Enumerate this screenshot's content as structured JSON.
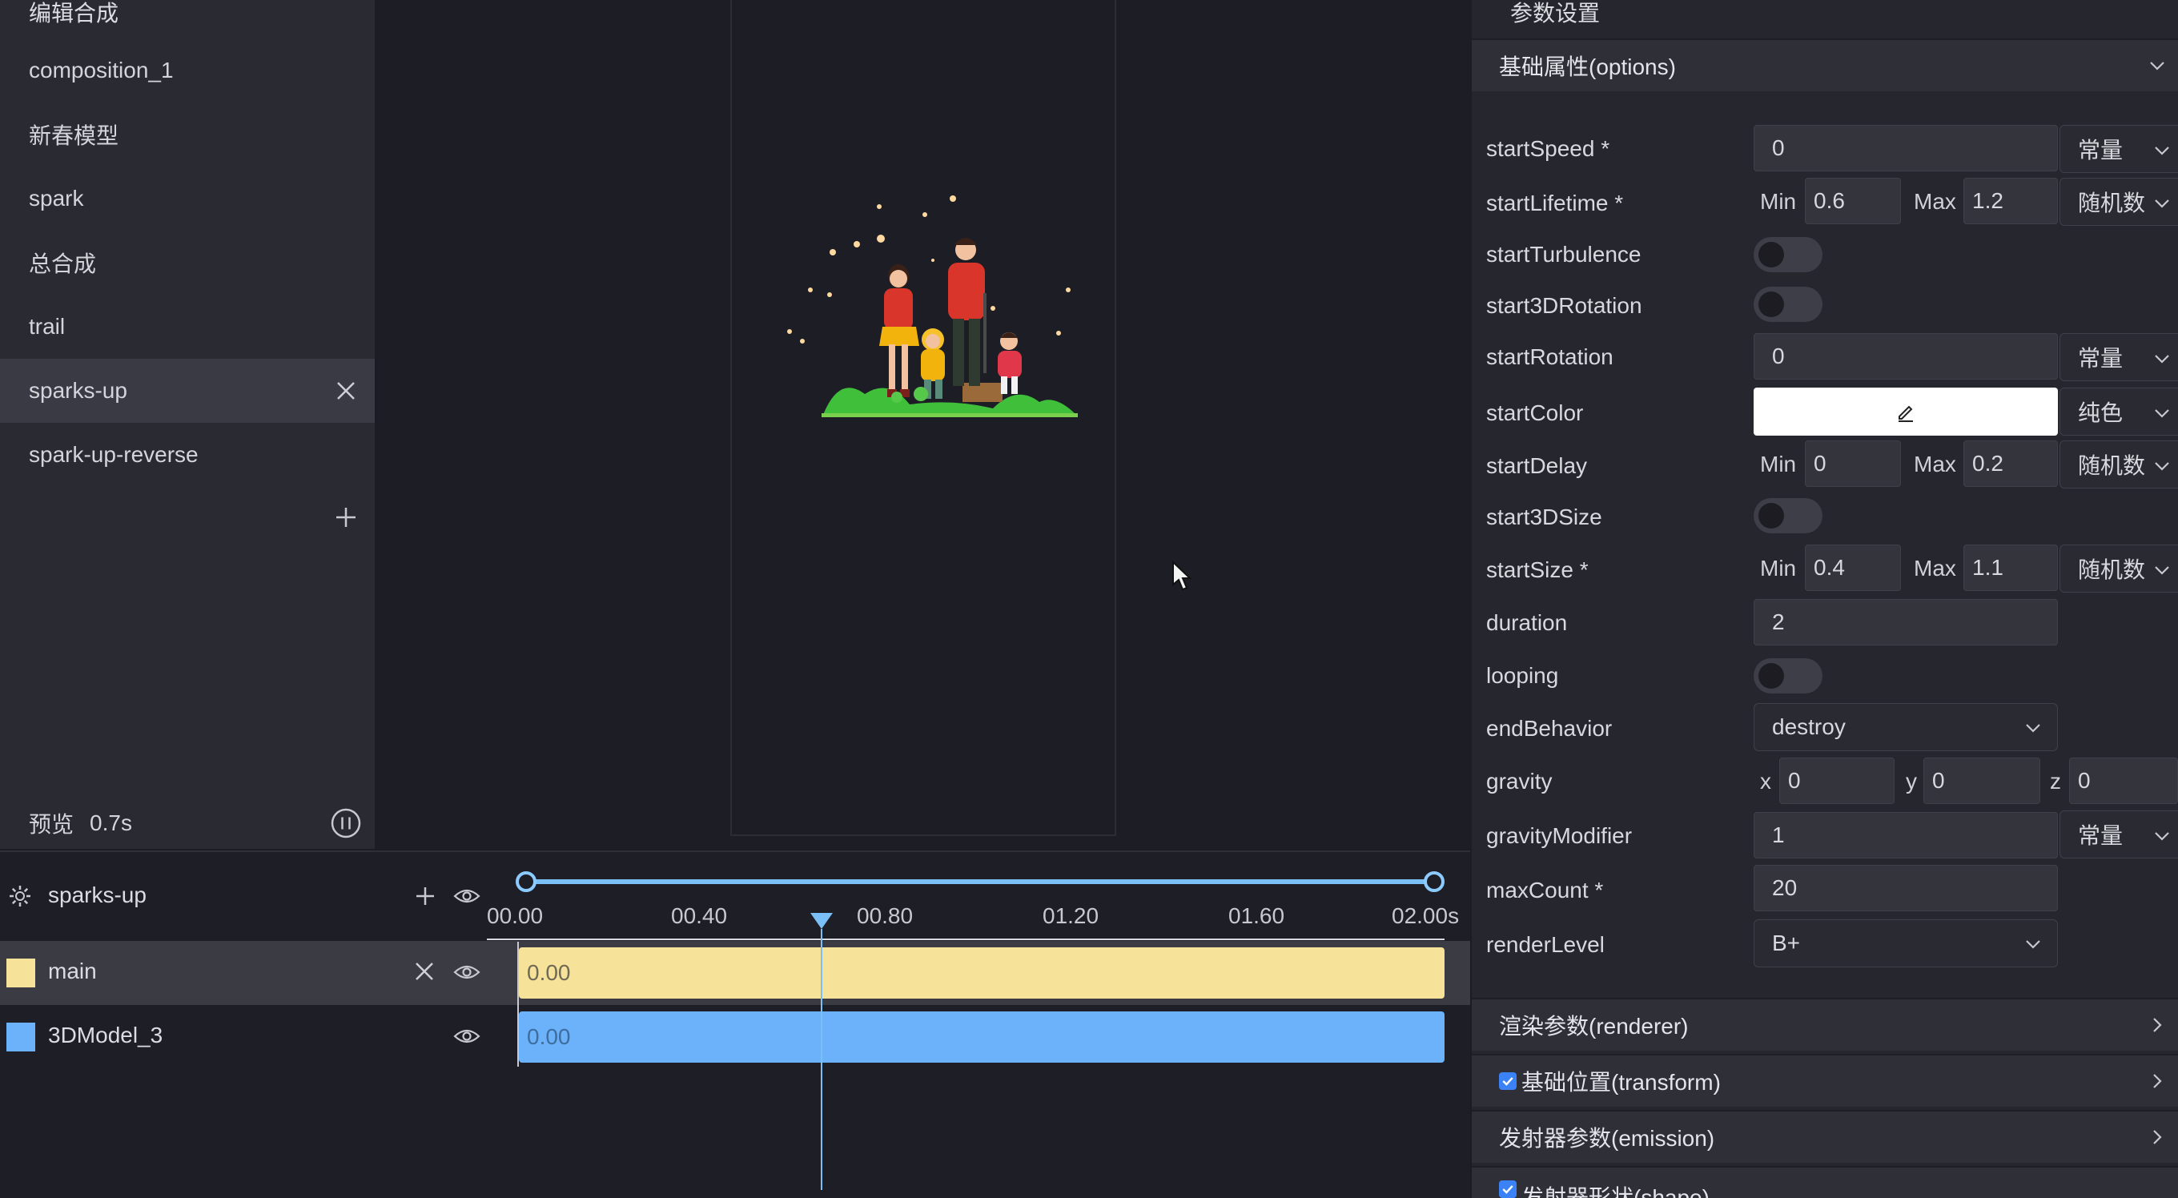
{
  "sidebar": {
    "title": "编辑合成",
    "compositions": [
      "composition_1",
      "新春模型",
      "spark",
      "总合成",
      "trail",
      "sparks-up",
      "spark-up-reverse"
    ],
    "selected_index": 5,
    "preview_label": "预览",
    "preview_time": "0.7s"
  },
  "timeline": {
    "composition": "sparks-up",
    "ticks": [
      "00.00",
      "00.40",
      "00.80",
      "01.20",
      "01.60",
      "02.00s"
    ],
    "playhead_seconds": 0.7,
    "tracks": [
      {
        "name": "main",
        "start_label": "0.00",
        "color": "#f7e29a"
      },
      {
        "name": "3DModel_3",
        "start_label": "0.00",
        "color": "#6bb2fa"
      }
    ]
  },
  "panel": {
    "title": "参数设置",
    "sections": {
      "options": "基础属性(options)",
      "renderer": "渲染参数(renderer)",
      "transform": "基础位置(transform)",
      "emission": "发射器参数(emission)",
      "shape": "发射器形状(shape)"
    },
    "props": {
      "startSpeed": {
        "label": "startSpeed *",
        "value": "0",
        "mode": "常量"
      },
      "startLifetime": {
        "label": "startLifetime *",
        "min_label": "Min",
        "min": "0.6",
        "max_label": "Max",
        "max": "1.2",
        "mode": "随机数"
      },
      "startTurbulence": {
        "label": "startTurbulence",
        "on": false
      },
      "start3DRotation": {
        "label": "start3DRotation",
        "on": false
      },
      "startRotation": {
        "label": "startRotation",
        "value": "0",
        "mode": "常量"
      },
      "startColor": {
        "label": "startColor",
        "value": "#ffffff",
        "mode": "纯色"
      },
      "startDelay": {
        "label": "startDelay",
        "min_label": "Min",
        "min": "0",
        "max_label": "Max",
        "max": "0.2",
        "mode": "随机数"
      },
      "start3DSize": {
        "label": "start3DSize",
        "on": false
      },
      "startSize": {
        "label": "startSize *",
        "min_label": "Min",
        "min": "0.4",
        "max_label": "Max",
        "max": "1.1",
        "mode": "随机数"
      },
      "duration": {
        "label": "duration",
        "value": "2"
      },
      "looping": {
        "label": "looping",
        "on": false
      },
      "endBehavior": {
        "label": "endBehavior",
        "value": "destroy"
      },
      "gravity": {
        "label": "gravity",
        "x_label": "x",
        "x": "0",
        "y_label": "y",
        "y": "0",
        "z_label": "z",
        "z": "0"
      },
      "gravityModifier": {
        "label": "gravityModifier",
        "value": "1",
        "mode": "常量"
      },
      "maxCount": {
        "label": "maxCount *",
        "value": "20"
      },
      "renderLevel": {
        "label": "renderLevel",
        "value": "B+"
      }
    }
  }
}
